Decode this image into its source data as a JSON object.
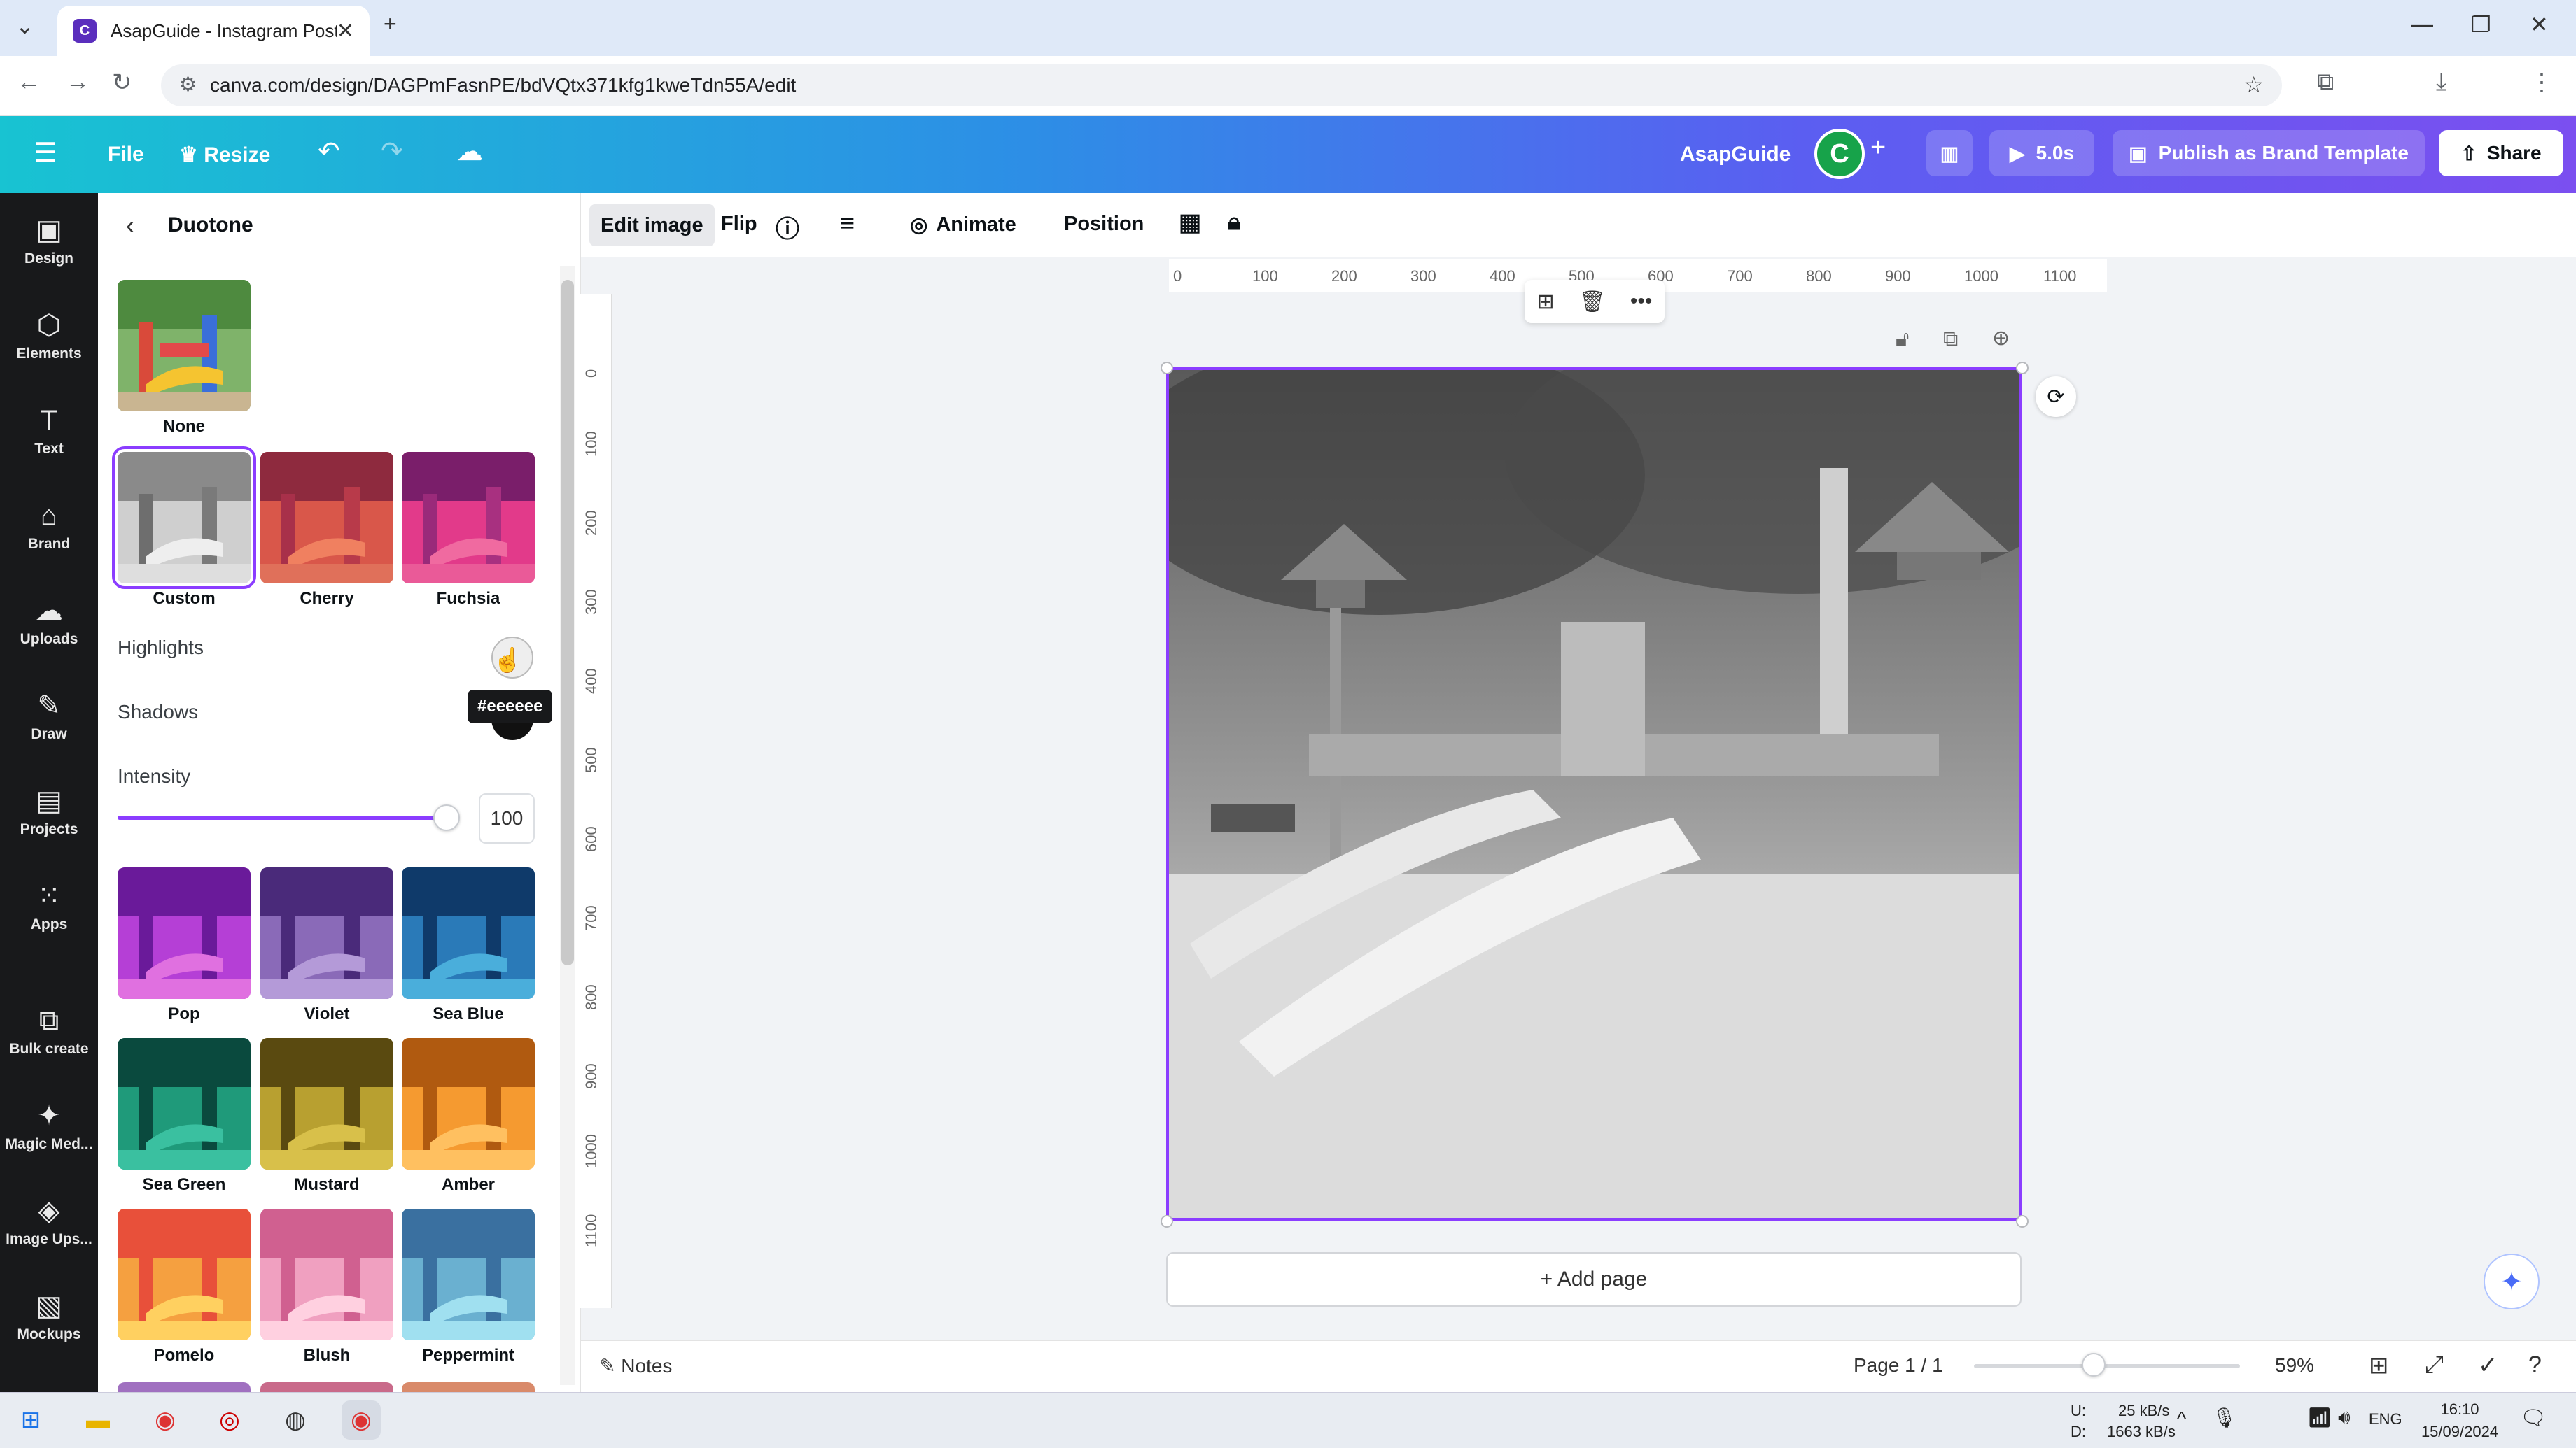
{
  "browser": {
    "tab_title": "AsapGuide - Instagram Post",
    "url": "canva.com/design/DAGPmFasnPE/bdVQtx371kfg1kweTdn55A/edit"
  },
  "header": {
    "file_label": "File",
    "resize_label": "Resize",
    "brand_name": "AsapGuide",
    "avatar_initial": "C",
    "play_label": "5.0s",
    "publish_label": "Publish as Brand Template",
    "share_label": "Share"
  },
  "rail": {
    "items": [
      {
        "label": "Design",
        "icon": "design-icon"
      },
      {
        "label": "Elements",
        "icon": "elements-icon"
      },
      {
        "label": "Text",
        "icon": "text-icon"
      },
      {
        "label": "Brand",
        "icon": "brand-icon"
      },
      {
        "label": "Uploads",
        "icon": "uploads-icon"
      },
      {
        "label": "Draw",
        "icon": "draw-icon"
      },
      {
        "label": "Projects",
        "icon": "projects-icon"
      },
      {
        "label": "Apps",
        "icon": "apps-icon"
      },
      {
        "label": "Bulk create",
        "icon": "bulk-create-icon"
      },
      {
        "label": "Magic Med...",
        "icon": "magic-media-icon"
      },
      {
        "label": "Image Ups...",
        "icon": "image-upscaler-icon"
      },
      {
        "label": "Mockups",
        "icon": "mockups-icon"
      }
    ]
  },
  "panel": {
    "title": "Duotone",
    "none_label": "None",
    "presets_top": [
      "Custom",
      "Cherry",
      "Fuchsia"
    ],
    "highlights_label": "Highlights",
    "shadows_label": "Shadows",
    "tooltip": "#eeeeee",
    "intensity_label": "Intensity",
    "intensity_value": "100",
    "intensity_fraction": 1.0,
    "presets": [
      "Pop",
      "Violet",
      "Sea Blue",
      "Sea Green",
      "Mustard",
      "Amber",
      "Pomelo",
      "Blush",
      "Peppermint"
    ],
    "highlight_color": "#eeeeee",
    "shadow_color": "#111111"
  },
  "toolbar": {
    "edit_image": "Edit image",
    "flip": "Flip",
    "animate": "Animate",
    "position": "Position"
  },
  "ruler": {
    "top": [
      "0",
      "100",
      "200",
      "300",
      "400",
      "500",
      "600",
      "700",
      "800",
      "900",
      "1000",
      "1100"
    ],
    "left": [
      "0",
      "100",
      "200",
      "300",
      "400",
      "500",
      "600",
      "700",
      "800",
      "900",
      "1000",
      "1100"
    ]
  },
  "canvas": {
    "add_page": "+ Add page"
  },
  "bottom": {
    "notes": "Notes",
    "page": "Page 1 / 1",
    "zoom": "59%",
    "zoom_fraction": 0.45
  },
  "taskbar": {
    "net_up": "25 kB/s",
    "net_down": "1663 kB/s",
    "lang": "ENG",
    "time": "16:10",
    "date": "15/09/2024",
    "net_u_label": "U:",
    "net_d_label": "D:"
  },
  "accent": "#8b3dff"
}
